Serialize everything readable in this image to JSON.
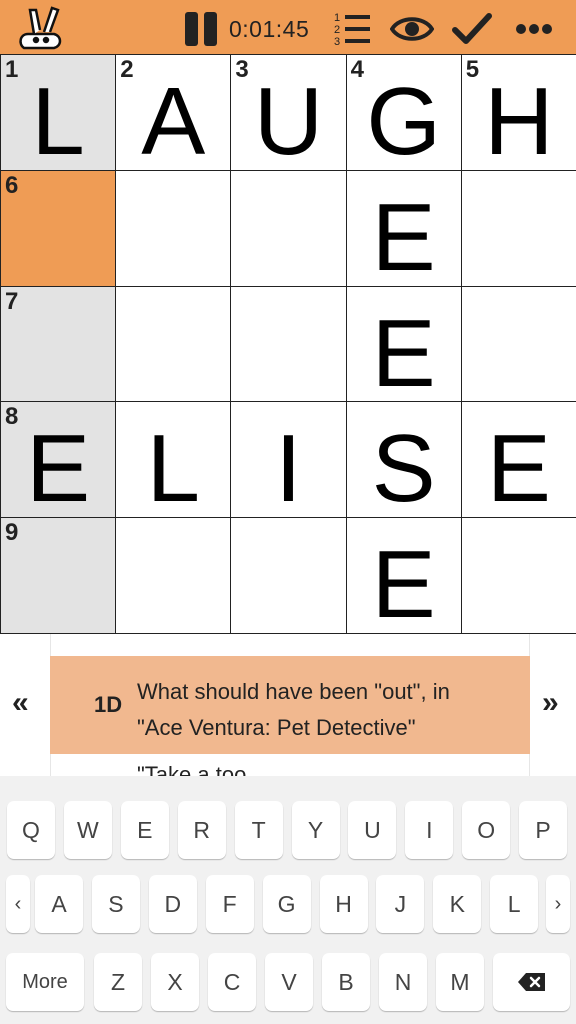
{
  "timer": "0:01:45",
  "colors": {
    "accent": "#ef9c55",
    "selected_word": "#e3e3e3",
    "clue_highlight": "#f1b88f"
  },
  "toolbar_icons": [
    "pause-icon",
    "list-icon",
    "eye-icon",
    "check-icon",
    "more-icon"
  ],
  "grid": {
    "rows": [
      [
        {
          "num": "1",
          "letter": "L"
        },
        {
          "num": "2",
          "letter": "A"
        },
        {
          "num": "3",
          "letter": "U"
        },
        {
          "num": "4",
          "letter": "G"
        },
        {
          "num": "5",
          "letter": "H"
        }
      ],
      [
        {
          "num": "6",
          "letter": ""
        },
        {
          "num": "",
          "letter": ""
        },
        {
          "num": "",
          "letter": ""
        },
        {
          "num": "",
          "letter": "E"
        },
        {
          "num": "",
          "letter": ""
        }
      ],
      [
        {
          "num": "7",
          "letter": ""
        },
        {
          "num": "",
          "letter": ""
        },
        {
          "num": "",
          "letter": ""
        },
        {
          "num": "",
          "letter": "E"
        },
        {
          "num": "",
          "letter": ""
        }
      ],
      [
        {
          "num": "8",
          "letter": "E"
        },
        {
          "num": "",
          "letter": "L"
        },
        {
          "num": "",
          "letter": "I"
        },
        {
          "num": "",
          "letter": "S"
        },
        {
          "num": "",
          "letter": "E"
        }
      ],
      [
        {
          "num": "9",
          "letter": ""
        },
        {
          "num": "",
          "letter": ""
        },
        {
          "num": "",
          "letter": ""
        },
        {
          "num": "",
          "letter": "E"
        },
        {
          "num": "",
          "letter": ""
        }
      ]
    ],
    "selected_cell": "row 2, column 1",
    "selected_word": "column 1 (1D)"
  },
  "clue": {
    "prev_arrow": "«",
    "next_arrow": "»",
    "number": "1D",
    "text_line1": "What should have been \"out\", in",
    "text_line2": "\"Ace Ventura: Pet Detective\"",
    "next_text_partial": "\"Take a too…"
  },
  "keyboard": {
    "row1": [
      "Q",
      "W",
      "E",
      "R",
      "T",
      "Y",
      "U",
      "I",
      "O",
      "P"
    ],
    "row2": [
      "A",
      "S",
      "D",
      "F",
      "G",
      "H",
      "J",
      "K",
      "L"
    ],
    "row3": [
      "Z",
      "X",
      "C",
      "V",
      "B",
      "N",
      "M"
    ],
    "left_arrow": "‹",
    "right_arrow": "›",
    "more_label": "More",
    "backspace_icon": "backspace-icon"
  }
}
